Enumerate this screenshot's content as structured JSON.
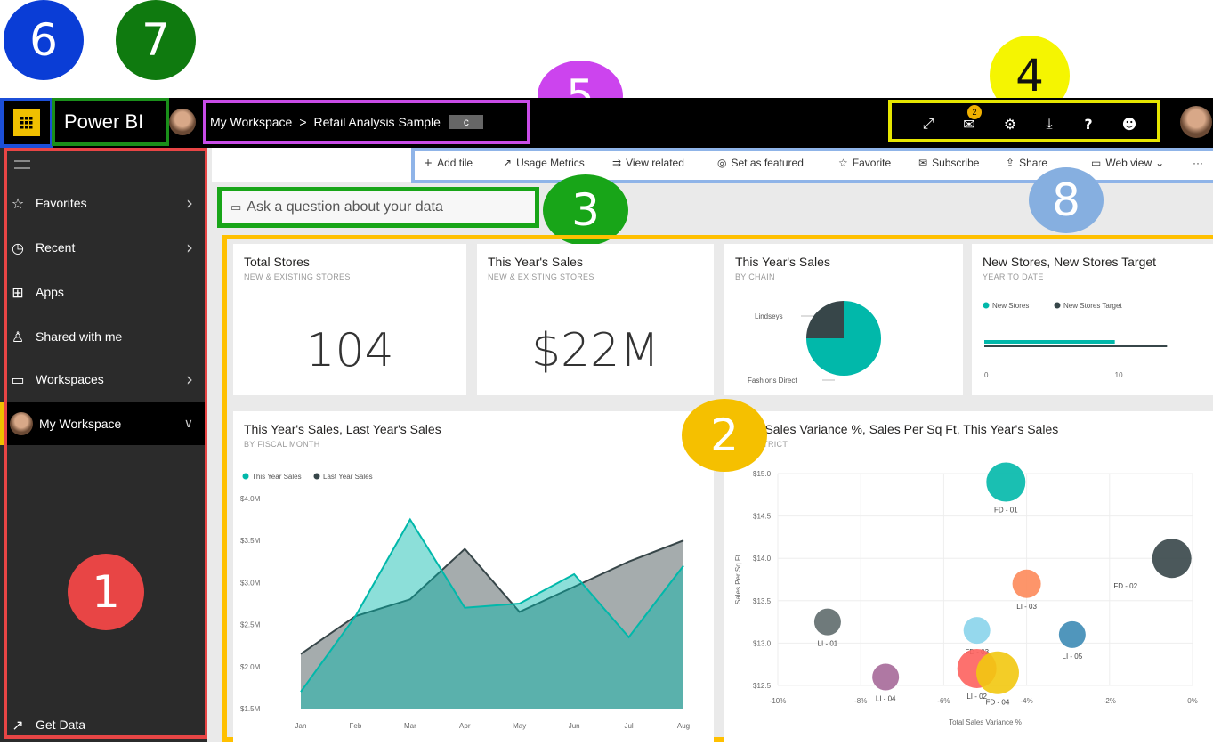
{
  "callouts": [
    "1",
    "2",
    "3",
    "4",
    "5",
    "6",
    "7",
    "8"
  ],
  "header": {
    "app_launcher_icon": "waffle-icon",
    "app_name": "Power BI",
    "breadcrumb_workspace": "My Workspace",
    "breadcrumb_sep": ">",
    "breadcrumb_report": "Retail Analysis Sample",
    "breadcrumb_badge": "c",
    "notification_count": "2",
    "icons": [
      "expand-icon",
      "notifications-icon",
      "settings-icon",
      "download-icon",
      "help-icon",
      "feedback-icon"
    ]
  },
  "sidebar": {
    "items": [
      {
        "label": "Favorites",
        "icon": "star-icon"
      },
      {
        "label": "Recent",
        "icon": "clock-icon"
      },
      {
        "label": "Apps",
        "icon": "apps-icon"
      },
      {
        "label": "Shared with me",
        "icon": "shared-icon"
      },
      {
        "label": "Workspaces",
        "icon": "workspaces-icon"
      },
      {
        "label": "My Workspace",
        "icon": "avatar"
      }
    ],
    "get_data": "Get Data"
  },
  "actions": {
    "add_tile": "Add tile",
    "usage_metrics": "Usage Metrics",
    "view_related": "View related",
    "set_featured": "Set as featured",
    "favorite": "Favorite",
    "subscribe": "Subscribe",
    "share": "Share",
    "web_view": "Web view",
    "more": "···"
  },
  "qna": {
    "placeholder": "Ask a question about your data"
  },
  "tiles": {
    "total_stores": {
      "title": "Total Stores",
      "subtitle": "NEW & EXISTING STORES",
      "value": "104"
    },
    "sales": {
      "title": "This Year's Sales",
      "subtitle": "NEW & EXISTING STORES",
      "value": "$22M"
    },
    "chain": {
      "title": "This Year's Sales",
      "subtitle": "BY CHAIN"
    },
    "new_stores": {
      "title": "New Stores, New Stores Target",
      "subtitle": "YEAR TO DATE"
    },
    "monthly": {
      "title": "This Year's Sales, Last Year's Sales",
      "subtitle": "BY FISCAL MONTH"
    },
    "scatter": {
      "title": "Total Sales Variance %, Sales Per Sq Ft, This Year's Sales",
      "subtitle": "BY DISTRICT"
    }
  },
  "colors": {
    "teal": "#01b8aa",
    "dark": "#374649",
    "accent_yellow": "#ffc000"
  },
  "chart_data": [
    {
      "type": "pie",
      "categories": [
        "Fashions Direct",
        "Lindseys"
      ],
      "values": [
        75,
        25
      ],
      "labels": [
        "Fashions Direct",
        "Lindseys"
      ]
    },
    {
      "type": "bar",
      "series": [
        {
          "name": "New Stores",
          "values": [
            10
          ]
        },
        {
          "name": "New Stores Target",
          "values": [
            14
          ]
        }
      ],
      "ticks": [
        "0",
        "10"
      ],
      "xlim": [
        0,
        15
      ]
    },
    {
      "type": "area",
      "categories": [
        "Jan",
        "Feb",
        "Mar",
        "Apr",
        "May",
        "Jun",
        "Jul",
        "Aug"
      ],
      "series": [
        {
          "name": "This Year Sales",
          "values": [
            1.7,
            2.6,
            3.75,
            2.7,
            2.75,
            3.1,
            2.35,
            3.2
          ]
        },
        {
          "name": "Last Year Sales",
          "values": [
            2.15,
            2.6,
            2.8,
            3.4,
            2.65,
            2.95,
            3.25,
            3.5
          ]
        }
      ],
      "yticks": [
        "$1.5M",
        "$2.0M",
        "$2.5M",
        "$3.0M",
        "$3.5M",
        "$4.0M"
      ],
      "ylim": [
        1.5,
        4.0
      ]
    },
    {
      "type": "scatter",
      "xlabel": "Total Sales Variance %",
      "ylabel": "Sales Per Sq Ft",
      "xticks": [
        "-10%",
        "-8%",
        "-6%",
        "-4%",
        "-2%",
        "0%"
      ],
      "yticks": [
        "$12.5",
        "$13.0",
        "$13.5",
        "$14.0",
        "$14.5",
        "$15.0"
      ],
      "xlim": [
        -10,
        0
      ],
      "ylim": [
        12.5,
        15.0
      ],
      "points": [
        {
          "label": "FD - 01",
          "x": -4.5,
          "y": 14.9,
          "size": 22,
          "color": "#01b8aa"
        },
        {
          "label": "FD - 02",
          "x": -0.5,
          "y": 14.0,
          "size": 22,
          "color": "#374649"
        },
        {
          "label": "LI - 03",
          "x": -4.0,
          "y": 13.7,
          "size": 16,
          "color": "#fd8a5a"
        },
        {
          "label": "LI - 01",
          "x": -8.8,
          "y": 13.25,
          "size": 15,
          "color": "#5f6b6d"
        },
        {
          "label": "FD - 03",
          "x": -5.2,
          "y": 13.15,
          "size": 15,
          "color": "#8ad4eb"
        },
        {
          "label": "LI - 05",
          "x": -2.9,
          "y": 13.1,
          "size": 15,
          "color": "#3d8bb5"
        },
        {
          "label": "LI - 04",
          "x": -7.4,
          "y": 12.6,
          "size": 15,
          "color": "#a66999"
        },
        {
          "label": "LI - 02",
          "x": -5.2,
          "y": 12.7,
          "size": 22,
          "color": "#fd625e"
        },
        {
          "label": "FD - 04",
          "x": -4.7,
          "y": 12.65,
          "size": 24,
          "color": "#f2c80f"
        }
      ]
    }
  ]
}
